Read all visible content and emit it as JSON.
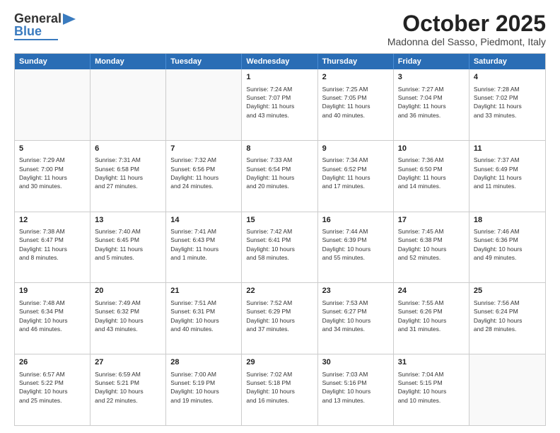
{
  "header": {
    "logo_line1": "General",
    "logo_line2": "Blue",
    "month": "October 2025",
    "location": "Madonna del Sasso, Piedmont, Italy"
  },
  "days_of_week": [
    "Sunday",
    "Monday",
    "Tuesday",
    "Wednesday",
    "Thursday",
    "Friday",
    "Saturday"
  ],
  "rows": [
    [
      {
        "day": "",
        "info": ""
      },
      {
        "day": "",
        "info": ""
      },
      {
        "day": "",
        "info": ""
      },
      {
        "day": "1",
        "info": "Sunrise: 7:24 AM\nSunset: 7:07 PM\nDaylight: 11 hours\nand 43 minutes."
      },
      {
        "day": "2",
        "info": "Sunrise: 7:25 AM\nSunset: 7:05 PM\nDaylight: 11 hours\nand 40 minutes."
      },
      {
        "day": "3",
        "info": "Sunrise: 7:27 AM\nSunset: 7:04 PM\nDaylight: 11 hours\nand 36 minutes."
      },
      {
        "day": "4",
        "info": "Sunrise: 7:28 AM\nSunset: 7:02 PM\nDaylight: 11 hours\nand 33 minutes."
      }
    ],
    [
      {
        "day": "5",
        "info": "Sunrise: 7:29 AM\nSunset: 7:00 PM\nDaylight: 11 hours\nand 30 minutes."
      },
      {
        "day": "6",
        "info": "Sunrise: 7:31 AM\nSunset: 6:58 PM\nDaylight: 11 hours\nand 27 minutes."
      },
      {
        "day": "7",
        "info": "Sunrise: 7:32 AM\nSunset: 6:56 PM\nDaylight: 11 hours\nand 24 minutes."
      },
      {
        "day": "8",
        "info": "Sunrise: 7:33 AM\nSunset: 6:54 PM\nDaylight: 11 hours\nand 20 minutes."
      },
      {
        "day": "9",
        "info": "Sunrise: 7:34 AM\nSunset: 6:52 PM\nDaylight: 11 hours\nand 17 minutes."
      },
      {
        "day": "10",
        "info": "Sunrise: 7:36 AM\nSunset: 6:50 PM\nDaylight: 11 hours\nand 14 minutes."
      },
      {
        "day": "11",
        "info": "Sunrise: 7:37 AM\nSunset: 6:49 PM\nDaylight: 11 hours\nand 11 minutes."
      }
    ],
    [
      {
        "day": "12",
        "info": "Sunrise: 7:38 AM\nSunset: 6:47 PM\nDaylight: 11 hours\nand 8 minutes."
      },
      {
        "day": "13",
        "info": "Sunrise: 7:40 AM\nSunset: 6:45 PM\nDaylight: 11 hours\nand 5 minutes."
      },
      {
        "day": "14",
        "info": "Sunrise: 7:41 AM\nSunset: 6:43 PM\nDaylight: 11 hours\nand 1 minute."
      },
      {
        "day": "15",
        "info": "Sunrise: 7:42 AM\nSunset: 6:41 PM\nDaylight: 10 hours\nand 58 minutes."
      },
      {
        "day": "16",
        "info": "Sunrise: 7:44 AM\nSunset: 6:39 PM\nDaylight: 10 hours\nand 55 minutes."
      },
      {
        "day": "17",
        "info": "Sunrise: 7:45 AM\nSunset: 6:38 PM\nDaylight: 10 hours\nand 52 minutes."
      },
      {
        "day": "18",
        "info": "Sunrise: 7:46 AM\nSunset: 6:36 PM\nDaylight: 10 hours\nand 49 minutes."
      }
    ],
    [
      {
        "day": "19",
        "info": "Sunrise: 7:48 AM\nSunset: 6:34 PM\nDaylight: 10 hours\nand 46 minutes."
      },
      {
        "day": "20",
        "info": "Sunrise: 7:49 AM\nSunset: 6:32 PM\nDaylight: 10 hours\nand 43 minutes."
      },
      {
        "day": "21",
        "info": "Sunrise: 7:51 AM\nSunset: 6:31 PM\nDaylight: 10 hours\nand 40 minutes."
      },
      {
        "day": "22",
        "info": "Sunrise: 7:52 AM\nSunset: 6:29 PM\nDaylight: 10 hours\nand 37 minutes."
      },
      {
        "day": "23",
        "info": "Sunrise: 7:53 AM\nSunset: 6:27 PM\nDaylight: 10 hours\nand 34 minutes."
      },
      {
        "day": "24",
        "info": "Sunrise: 7:55 AM\nSunset: 6:26 PM\nDaylight: 10 hours\nand 31 minutes."
      },
      {
        "day": "25",
        "info": "Sunrise: 7:56 AM\nSunset: 6:24 PM\nDaylight: 10 hours\nand 28 minutes."
      }
    ],
    [
      {
        "day": "26",
        "info": "Sunrise: 6:57 AM\nSunset: 5:22 PM\nDaylight: 10 hours\nand 25 minutes."
      },
      {
        "day": "27",
        "info": "Sunrise: 6:59 AM\nSunset: 5:21 PM\nDaylight: 10 hours\nand 22 minutes."
      },
      {
        "day": "28",
        "info": "Sunrise: 7:00 AM\nSunset: 5:19 PM\nDaylight: 10 hours\nand 19 minutes."
      },
      {
        "day": "29",
        "info": "Sunrise: 7:02 AM\nSunset: 5:18 PM\nDaylight: 10 hours\nand 16 minutes."
      },
      {
        "day": "30",
        "info": "Sunrise: 7:03 AM\nSunset: 5:16 PM\nDaylight: 10 hours\nand 13 minutes."
      },
      {
        "day": "31",
        "info": "Sunrise: 7:04 AM\nSunset: 5:15 PM\nDaylight: 10 hours\nand 10 minutes."
      },
      {
        "day": "",
        "info": ""
      }
    ]
  ]
}
